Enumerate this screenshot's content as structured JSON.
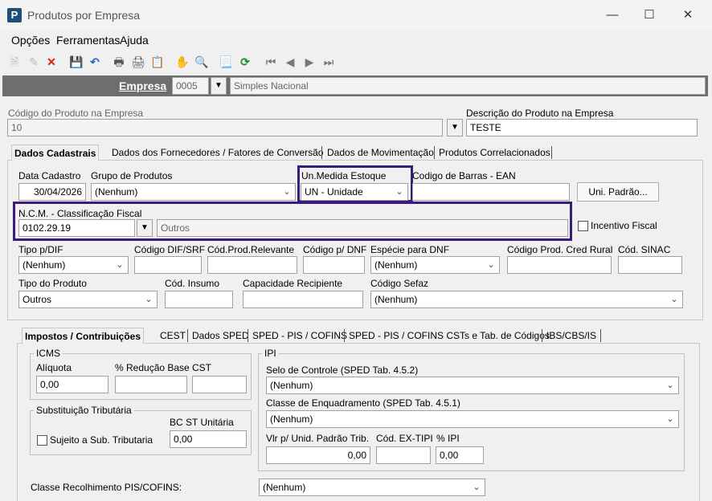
{
  "window": {
    "title": "Produtos por Empresa",
    "app_icon": "P"
  },
  "menu": [
    "Opções",
    "Ferramentas",
    "Ajuda"
  ],
  "empresa": {
    "label": "Empresa",
    "code": "0005",
    "name": "Simples Nacional"
  },
  "produto": {
    "code_label": "Código do Produto na Empresa",
    "code_value": "10",
    "desc_label": "Descrição do Produto na Empresa",
    "desc_value": "TESTE"
  },
  "main_tabs": [
    "Dados Cadastrais",
    "Dados dos Fornecedores / Fatores de Conversão",
    "Dados de Movimentação",
    "Produtos Correlacionados"
  ],
  "cadastro": {
    "data_label": "Data Cadastro",
    "data_value": "30/04/2026",
    "grupo_label": "Grupo de Produtos",
    "grupo_value": "(Nenhum)",
    "un_label": "Un.Medida Estoque",
    "un_value": "UN - Unidade",
    "ean_label": "Codigo de Barras - EAN",
    "ean_value": "",
    "uni_button": "Uni. Padrão...",
    "ncm_label": "N.C.M. -  Classificação Fiscal",
    "ncm_value": "0102.29.19",
    "ncm_desc": "Outros",
    "incentivo_label": "Incentivo Fiscal",
    "tipo_dif_label": "Tipo p/DIF",
    "tipo_dif_value": "(Nenhum)",
    "cod_dif_label": "Código DIF/SRF",
    "cod_prod_rel_label": "Cód.Prod.Relevante",
    "cod_dnf_label": "Código p/ DNF",
    "especie_dnf_label": "Espécie para DNF",
    "especie_dnf_value": "(Nenhum)",
    "cod_cred_rural_label": "Código Prod. Cred Rural",
    "cod_sinac_label": "Cód. SINAC",
    "tipo_prod_label": "Tipo do Produto",
    "tipo_prod_value": "Outros",
    "cod_insumo_label": "Cód. Insumo",
    "cap_recip_label": "Capacidade Recipiente",
    "cod_sefaz_label": "Código Sefaz",
    "cod_sefaz_value": "(Nenhum)"
  },
  "sub_tabs": [
    "Impostos / Contribuições",
    "CEST",
    "Dados SPED",
    "SPED - PIS / COFINS",
    "SPED - PIS / COFINS CSTs e Tab. de Códigos",
    "IBS/CBS/IS"
  ],
  "impostos": {
    "icms_title": "ICMS",
    "aliquota_label": "Alíquota",
    "aliquota_value": "0,00",
    "reducao_label": "% Redução Base",
    "cst_label": "CST",
    "subst_title": "Substituição Tributária",
    "sujeito_label": "Sujeito a Sub. Tributaria",
    "bc_st_label": "BC ST Unitária",
    "bc_st_value": "0,00",
    "ipi_title": "IPI",
    "selo_label": "Selo de Controle (SPED Tab. 4.5.2)",
    "selo_value": "(Nenhum)",
    "classe_enq_label": "Classe de Enquadramento (SPED Tab. 4.5.1)",
    "classe_enq_value": "(Nenhum)",
    "vlr_label": "Vlr p/ Unid. Padrão Trib.",
    "vlr_value": "0,00",
    "ex_tipi_label": "Cód. EX-TIPI",
    "ipi_pct_label": "% IPI",
    "ipi_pct_value": "0,00",
    "classe_pis_label": "Classe Recolhimento PIS/COFINS:",
    "classe_pis_value": "(Nenhum)"
  },
  "colors": {
    "highlight": "#3a1d7a",
    "empresa_bar": "#6e6e6e"
  }
}
